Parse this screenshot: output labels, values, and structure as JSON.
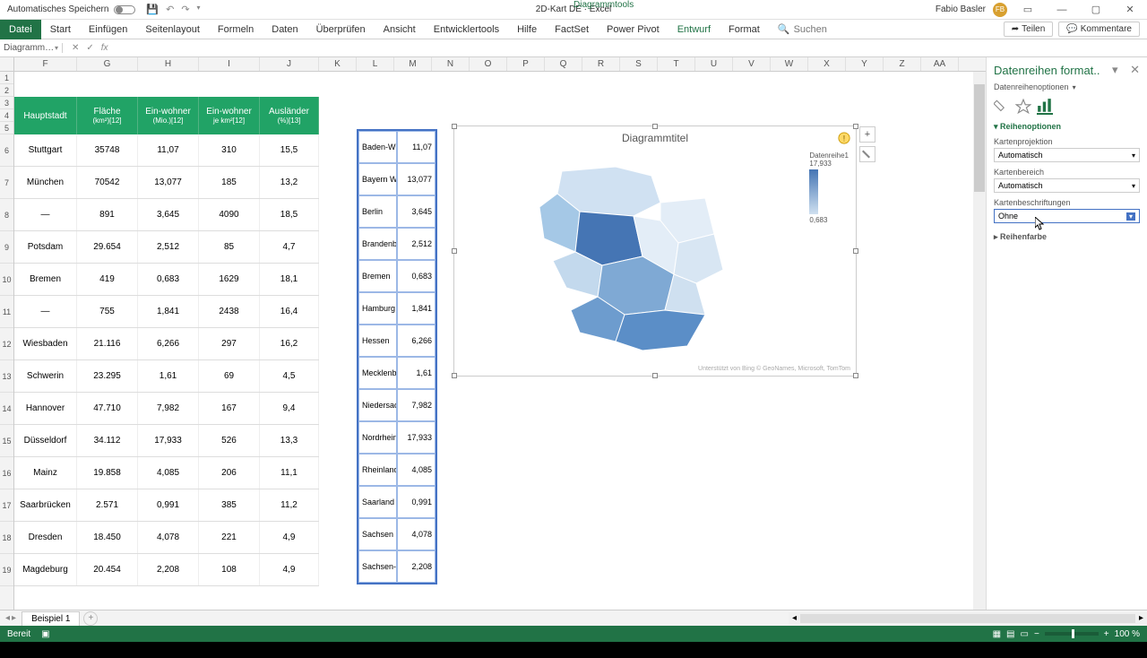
{
  "titlebar": {
    "autosave": "Automatisches Speichern",
    "doc_title": "2D-Kart DE · Excel",
    "tools_context": "Diagrammtools",
    "username": "Fabio Basler",
    "avatar": "FB"
  },
  "ribbon": {
    "tabs": [
      "Datei",
      "Start",
      "Einfügen",
      "Seitenlayout",
      "Formeln",
      "Daten",
      "Überprüfen",
      "Ansicht",
      "Entwicklertools",
      "Hilfe",
      "FactSet",
      "Power Pivot",
      "Entwurf",
      "Format"
    ],
    "active_index": 0,
    "search_placeholder": "Suchen",
    "share": "Teilen",
    "comments": "Kommentare"
  },
  "namebox": "Diagramm…",
  "columns": [
    "F",
    "G",
    "H",
    "I",
    "J",
    "K",
    "L",
    "M",
    "N",
    "O",
    "P",
    "Q",
    "R",
    "S",
    "T",
    "U",
    "V",
    "W",
    "X",
    "Y",
    "Z",
    "AA"
  ],
  "row_numbers": [
    1,
    2,
    3,
    4,
    5,
    6,
    7,
    8,
    9,
    10,
    11,
    12,
    13,
    14,
    15,
    16,
    17,
    18,
    19
  ],
  "table1": {
    "headers": [
      "Hauptstadt",
      "Fläche",
      "Ein-wohner",
      "Ein-wohner",
      "Ausländer"
    ],
    "subheaders": [
      "",
      "(km²)[12]",
      "(Mio.)[12]",
      "je km²[12]",
      "(%)[13]"
    ],
    "rows": [
      [
        "Stuttgart",
        "35748",
        "11,07",
        "310",
        "15,5"
      ],
      [
        "München",
        "70542",
        "13,077",
        "185",
        "13,2"
      ],
      [
        "—",
        "891",
        "3,645",
        "4090",
        "18,5"
      ],
      [
        "Potsdam",
        "29.654",
        "2,512",
        "85",
        "4,7"
      ],
      [
        "Bremen",
        "419",
        "0,683",
        "1629",
        "18,1"
      ],
      [
        "—",
        "755",
        "1,841",
        "2438",
        "16,4"
      ],
      [
        "Wiesbaden",
        "21.116",
        "6,266",
        "297",
        "16,2"
      ],
      [
        "Schwerin",
        "23.295",
        "1,61",
        "69",
        "4,5"
      ],
      [
        "Hannover",
        "47.710",
        "7,982",
        "167",
        "9,4"
      ],
      [
        "Düsseldorf",
        "34.112",
        "17,933",
        "526",
        "13,3"
      ],
      [
        "Mainz",
        "19.858",
        "4,085",
        "206",
        "11,1"
      ],
      [
        "Saarbrücken",
        "2.571",
        "0,991",
        "385",
        "11,2"
      ],
      [
        "Dresden",
        "18.450",
        "4,078",
        "221",
        "4,9"
      ],
      [
        "Magdeburg",
        "20.454",
        "2,208",
        "108",
        "4,9"
      ]
    ]
  },
  "table2": {
    "rows": [
      [
        "Baden-Wü",
        "11,07"
      ],
      [
        "Bayern W",
        "13,077"
      ],
      [
        "Berlin",
        "3,645"
      ],
      [
        "Brandenb",
        "2,512"
      ],
      [
        "Bremen",
        "0,683"
      ],
      [
        "Hamburg",
        "1,841"
      ],
      [
        "Hessen",
        "6,266"
      ],
      [
        "Mecklenb",
        "1,61"
      ],
      [
        "Niedersac",
        "7,982"
      ],
      [
        "Nordrhein",
        "17,933"
      ],
      [
        "Rheinland",
        "4,085"
      ],
      [
        "Saarland",
        "0,991"
      ],
      [
        "Sachsen",
        "4,078"
      ],
      [
        "Sachsen-A",
        "2,208"
      ]
    ]
  },
  "chart": {
    "title": "Diagrammtitel",
    "legend_label": "Datenreihe1",
    "legend_max": "17,933",
    "legend_min": "0,683",
    "credit": "Unterstützt von Bing © GeoNames, Microsoft, TomTom"
  },
  "chart_data": {
    "type": "heatmap",
    "title": "Diagrammtitel",
    "series_name": "Datenreihe1",
    "categories": [
      "Baden-Württemberg",
      "Bayern",
      "Berlin",
      "Brandenburg",
      "Bremen",
      "Hamburg",
      "Hessen",
      "Mecklenburg-Vorpommern",
      "Niedersachsen",
      "Nordrhein-Westfalen",
      "Rheinland-Pfalz",
      "Saarland",
      "Sachsen",
      "Sachsen-Anhalt"
    ],
    "values": [
      11.07,
      13.077,
      3.645,
      2.512,
      0.683,
      1.841,
      6.266,
      1.61,
      7.982,
      17.933,
      4.085,
      0.991,
      4.078,
      2.208
    ],
    "value_range": [
      0.683,
      17.933
    ]
  },
  "format_pane": {
    "title": "Datenreihen format..",
    "subtitle": "Datenreihenoptionen",
    "section_chain": "Reihenoptionen",
    "projection_label": "Kartenprojektion",
    "projection_value": "Automatisch",
    "area_label": "Kartenbereich",
    "area_value": "Automatisch",
    "labels_label": "Kartenbeschriftungen",
    "labels_value": "Ohne",
    "fill_section": "Reihenfarbe"
  },
  "sheet": {
    "active": "Beispiel 1"
  },
  "status": {
    "ready": "Bereit",
    "zoom": "100 %"
  }
}
